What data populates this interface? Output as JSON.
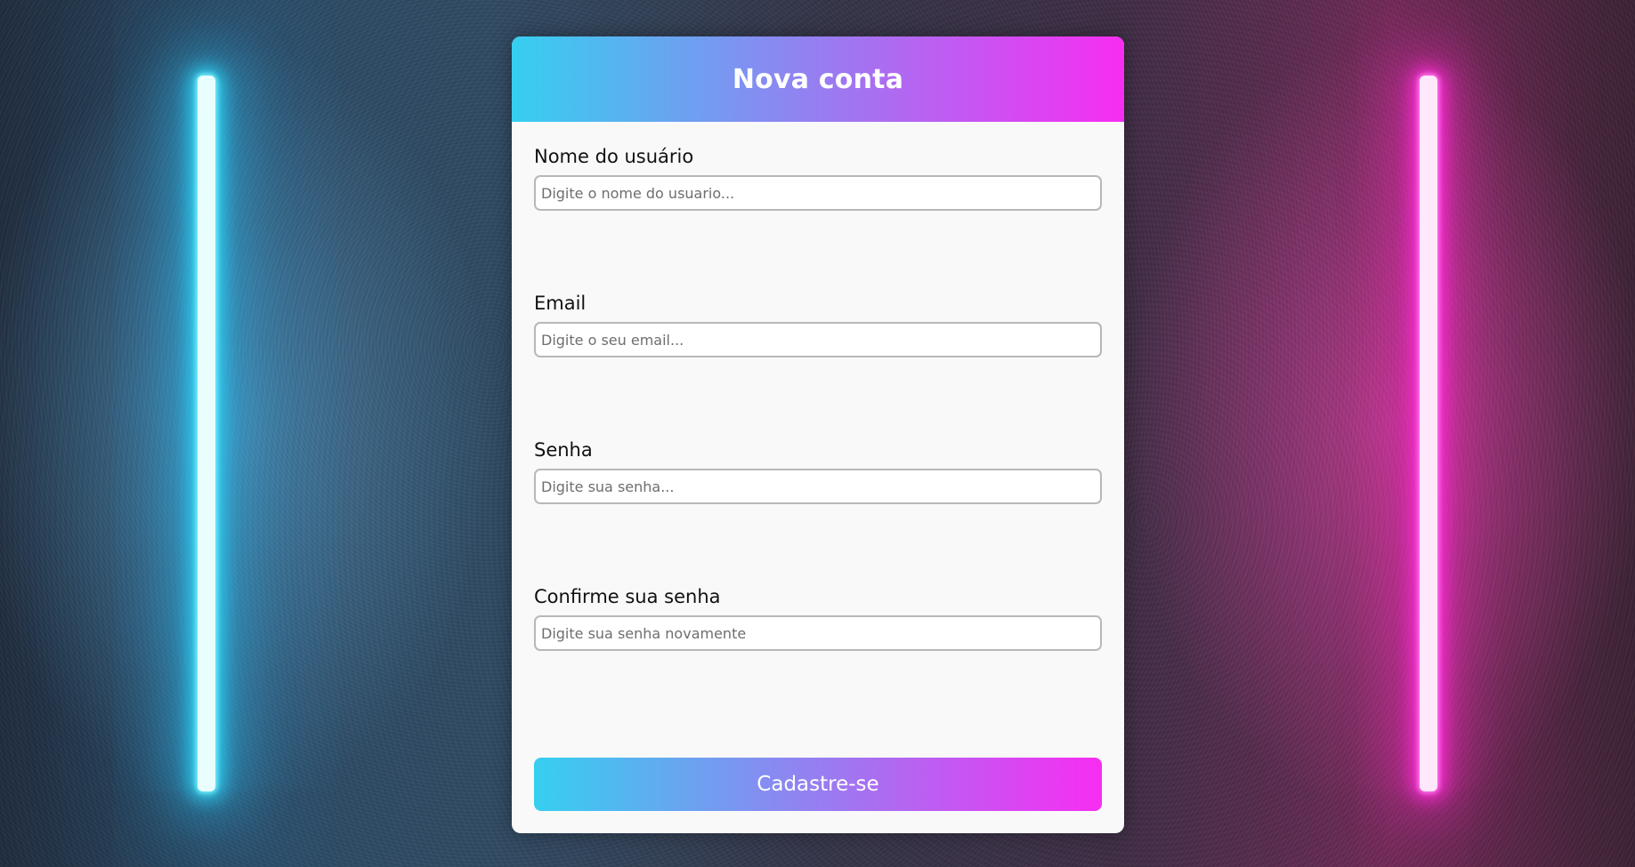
{
  "form": {
    "title": "Nova conta",
    "fields": [
      {
        "label": "Nome do usuário",
        "placeholder": "Digite o nome do usuario..."
      },
      {
        "label": "Email",
        "placeholder": "Digite o seu email..."
      },
      {
        "label": "Senha",
        "placeholder": "Digite sua senha..."
      },
      {
        "label": "Confirme sua senha",
        "placeholder": "Digite sua senha novamente"
      }
    ],
    "submit_label": "Cadastre-se"
  },
  "colors": {
    "gradient_start": "#36cff0",
    "gradient_end": "#f72df2",
    "card_background": "#f9f9f9",
    "neon_left": "#2fd3f5",
    "neon_right": "#ff2ad8"
  }
}
